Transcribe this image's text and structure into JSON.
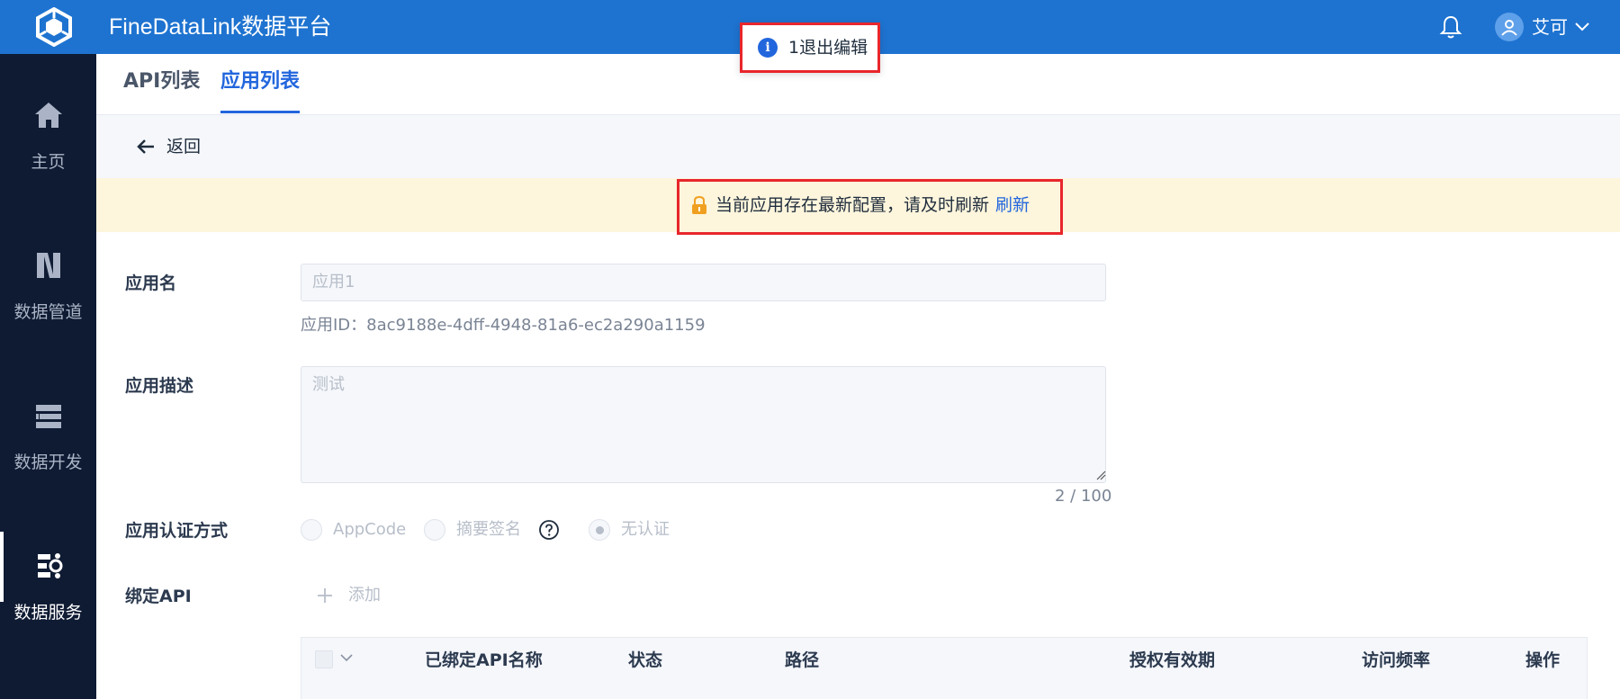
{
  "header": {
    "app_title": "FineDataLink数据平台",
    "user_name": "艾可",
    "brand_color": "#1e73d0"
  },
  "sidebar": {
    "items": [
      {
        "label": "主页",
        "icon": "home-icon"
      },
      {
        "label": "数据管道",
        "icon": "pipeline-icon"
      },
      {
        "label": "数据开发",
        "icon": "development-icon"
      },
      {
        "label": "数据服务",
        "icon": "data-service-icon",
        "active": true
      }
    ]
  },
  "tabs": [
    {
      "label": "API列表"
    },
    {
      "label": "应用列表",
      "active": true
    }
  ],
  "back": {
    "label": "返回"
  },
  "warning": {
    "text": "当前应用存在最新配置，请及时刷新",
    "link": "刷新"
  },
  "toast": {
    "text": "1退出编辑"
  },
  "form": {
    "app_name_label": "应用名",
    "app_name_placeholder": "应用1",
    "app_id_text": "应用ID：8ac9188e-4dff-4948-81a6-ec2a290a1159",
    "desc_label": "应用描述",
    "desc_placeholder": "测试",
    "desc_counter": "2 / 100",
    "auth_label": "应用认证方式",
    "auth_options": [
      {
        "label": "AppCode",
        "checked": false
      },
      {
        "label": "摘要签名",
        "checked": false
      },
      {
        "label": "无认证",
        "checked": true
      }
    ],
    "bind_label": "绑定API",
    "add_label": "添加"
  },
  "table": {
    "columns": [
      "已绑定API名称",
      "状态",
      "路径",
      "授权有效期",
      "访问频率",
      "操作"
    ]
  }
}
